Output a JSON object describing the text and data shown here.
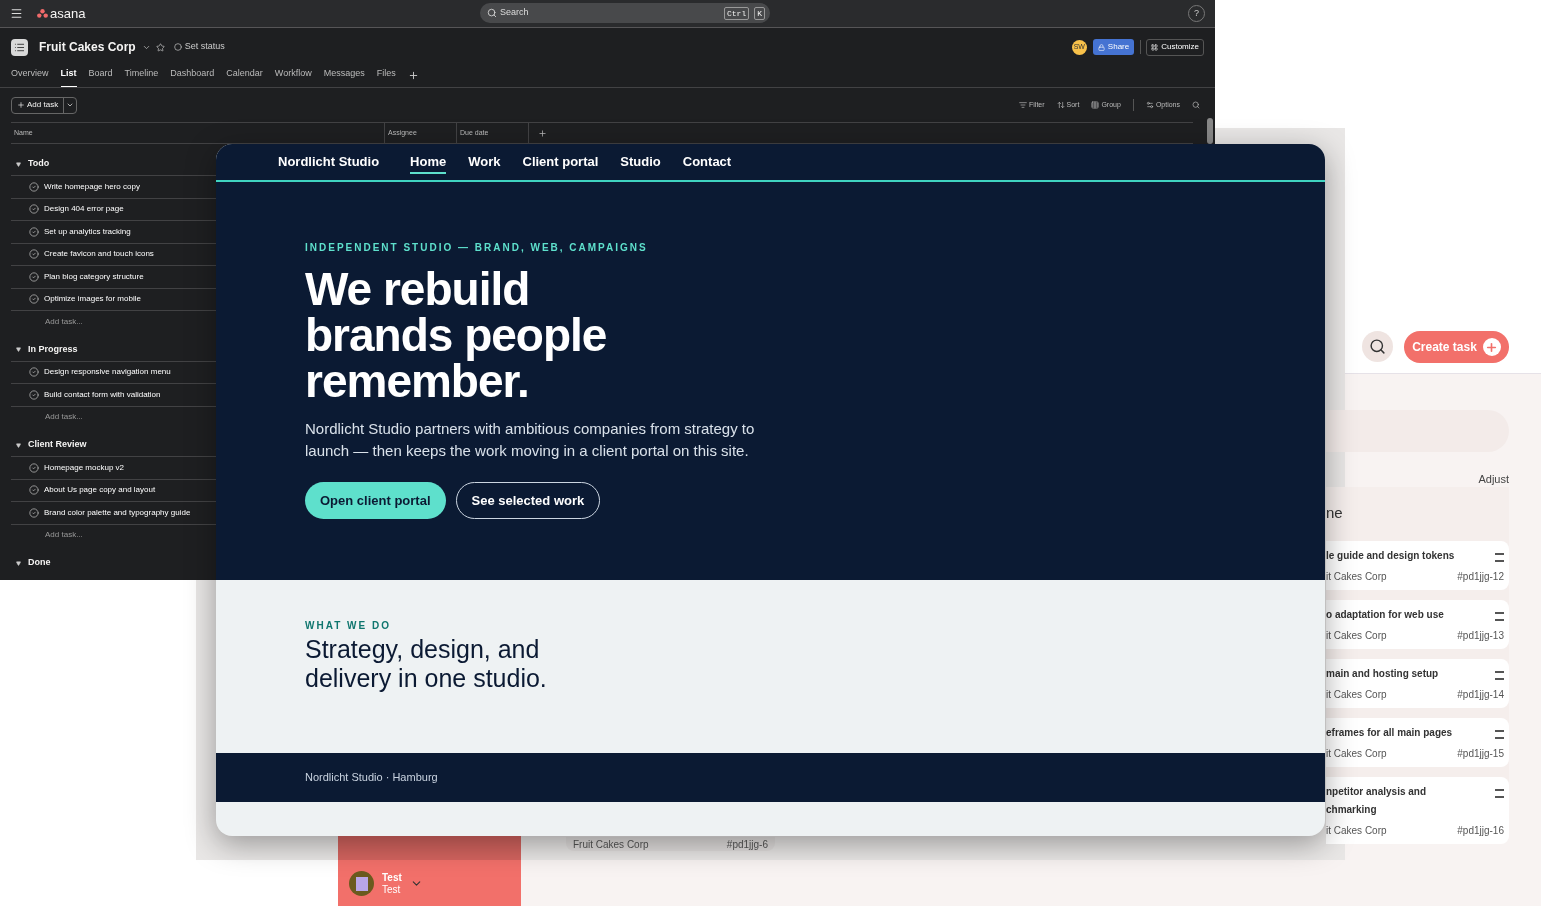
{
  "board": {
    "create_task": "Create task",
    "adjust": "Adjust",
    "column_title": "ne",
    "cards": [
      {
        "title": "le guide and design tokens",
        "project": "it Cakes Corp",
        "id": "#pd1jjg-12"
      },
      {
        "title": "o adaptation for web use",
        "project": "it Cakes Corp",
        "id": "#pd1jjg-13"
      },
      {
        "title": "main and hosting setup",
        "project": "it Cakes Corp",
        "id": "#pd1jjg-14"
      },
      {
        "title": "eframes for all main pages",
        "project": "it Cakes Corp",
        "id": "#pd1jjg-15"
      },
      {
        "title": "npetitor analysis and chmarking",
        "project": "it Cakes Corp",
        "id": "#pd1jjg-16"
      }
    ],
    "partial_card": {
      "project": "Fruit Cakes Corp",
      "id": "#pd1jjg-6"
    },
    "user": {
      "name": "Test",
      "subtitle": "Test"
    }
  },
  "asana": {
    "logo": "asana",
    "search": {
      "placeholder": "Search"
    },
    "shortcut_keys": [
      "Ctrl",
      "K"
    ],
    "help": "?",
    "project": {
      "title": "Fruit Cakes Corp",
      "status": "Set status"
    },
    "avatar": "SW",
    "share": "Share",
    "customize": "Customize",
    "tabs": [
      {
        "label": "Overview",
        "selected": false
      },
      {
        "label": "List",
        "selected": true
      },
      {
        "label": "Board",
        "selected": false
      },
      {
        "label": "Timeline",
        "selected": false
      },
      {
        "label": "Dashboard",
        "selected": false
      },
      {
        "label": "Calendar",
        "selected": false
      },
      {
        "label": "Workflow",
        "selected": false
      },
      {
        "label": "Messages",
        "selected": false
      },
      {
        "label": "Files",
        "selected": false
      }
    ],
    "add_task": "Add task",
    "toolbar": [
      "Filter",
      "Sort",
      "Group",
      "Options"
    ],
    "columns": [
      "Name",
      "Assignee",
      "Due date"
    ],
    "sections": [
      {
        "name": "Todo",
        "expanded": true,
        "tasks": [
          "Write homepage hero copy",
          "Design 404 error page",
          "Set up analytics tracking",
          "Create favicon and touch icons",
          "Plan blog category structure",
          "Optimize images for mobile"
        ],
        "add": "Add task..."
      },
      {
        "name": "In Progress",
        "expanded": true,
        "tasks": [
          "Design responsive navigation menu",
          "Build contact form with validation"
        ],
        "add": "Add task..."
      },
      {
        "name": "Client Review",
        "expanded": true,
        "tasks": [
          "Homepage mockup v2",
          "About Us page copy and layout",
          "Brand color palette and typography guide"
        ],
        "add": "Add task..."
      },
      {
        "name": "Done",
        "expanded": true
      }
    ]
  },
  "site": {
    "brand": "Nordlicht Studio",
    "nav": [
      {
        "label": "Home",
        "selected": true
      },
      {
        "label": "Work",
        "selected": false
      },
      {
        "label": "Client portal",
        "selected": false
      },
      {
        "label": "Studio",
        "selected": false
      },
      {
        "label": "Contact",
        "selected": false
      }
    ],
    "eyebrow": "INDEPENDENT STUDIO — BRAND, WEB, CAMPAIGNS",
    "headline": "We rebuild brands people remember.",
    "lead": "Nordlicht Studio partners with ambitious companies from strategy to launch — then keeps the work moving in a client portal on this site.",
    "buttons": [
      {
        "label": "Open client portal",
        "kind": "primary"
      },
      {
        "label": "See selected work",
        "kind": "outline"
      }
    ],
    "section": {
      "eyebrow": "WHAT WE DO",
      "heading": "Strategy, design, and delivery in one studio."
    },
    "footer": "Nordlicht Studio · Hamburg"
  }
}
